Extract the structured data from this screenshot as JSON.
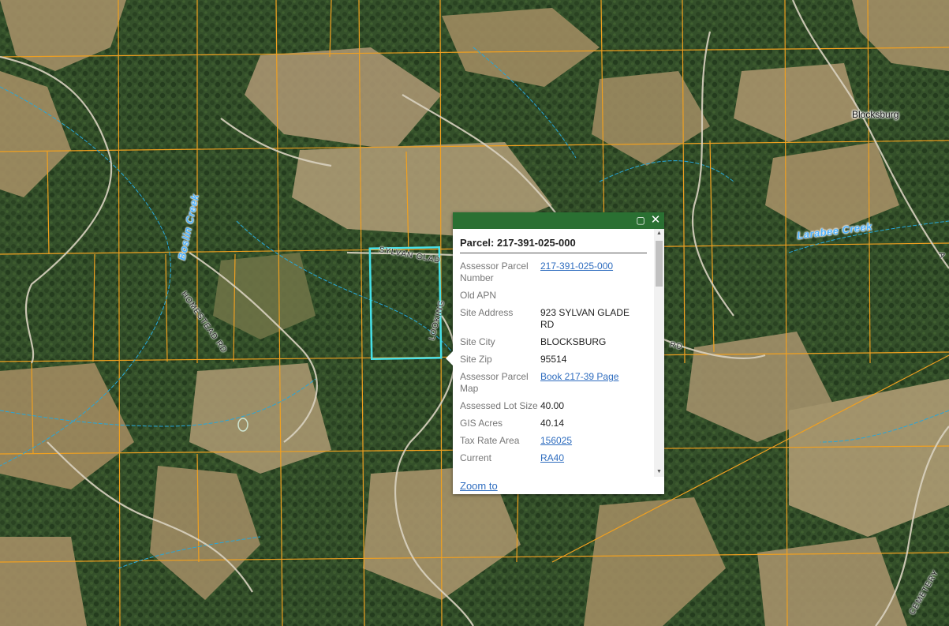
{
  "map": {
    "labels": {
      "town": "Blocksburg",
      "creek_1": "Boslin Creek",
      "creek_2": "Larabee Creek",
      "road_sylvan": "SYLVAN GLAD",
      "road_homestead": "HOMESTEAD RD",
      "road_rd": "RD",
      "road_lookout": "LOOKING",
      "road_rd2": "RD",
      "road_cemetery": "CEMETERY",
      "road_a": "A"
    },
    "colors": {
      "parcel_line": "#f0a020",
      "creek_line": "#27a6d9",
      "road_line": "#d9d2c0",
      "selection": "#46e0e8",
      "popup_header": "#2a7032"
    }
  },
  "popup": {
    "title": "Parcel: 217-391-025-000",
    "maximize_icon": "maximize-icon",
    "close_icon": "close-icon",
    "attributes": [
      {
        "key": "Assessor Parcel Number",
        "value": "217-391-025-000",
        "link": true
      },
      {
        "key": "Old APN",
        "value": "",
        "link": false
      },
      {
        "key": "Site Address",
        "value": "923 SYLVAN GLADE RD",
        "link": false
      },
      {
        "key": "Site City",
        "value": "BLOCKSBURG",
        "link": false
      },
      {
        "key": "Site Zip",
        "value": "95514",
        "link": false
      },
      {
        "key": "Assessor Parcel Map",
        "value": "Book 217-39 Page",
        "link": true
      },
      {
        "key": "Assessed Lot Size",
        "value": "40.00",
        "link": false
      },
      {
        "key": "GIS Acres",
        "value": "40.14",
        "link": false
      },
      {
        "key": "Tax Rate Area",
        "value": "156025",
        "link": true
      },
      {
        "key": "Current",
        "value": "RA40",
        "link": true
      }
    ],
    "zoom_label": "Zoom to"
  }
}
